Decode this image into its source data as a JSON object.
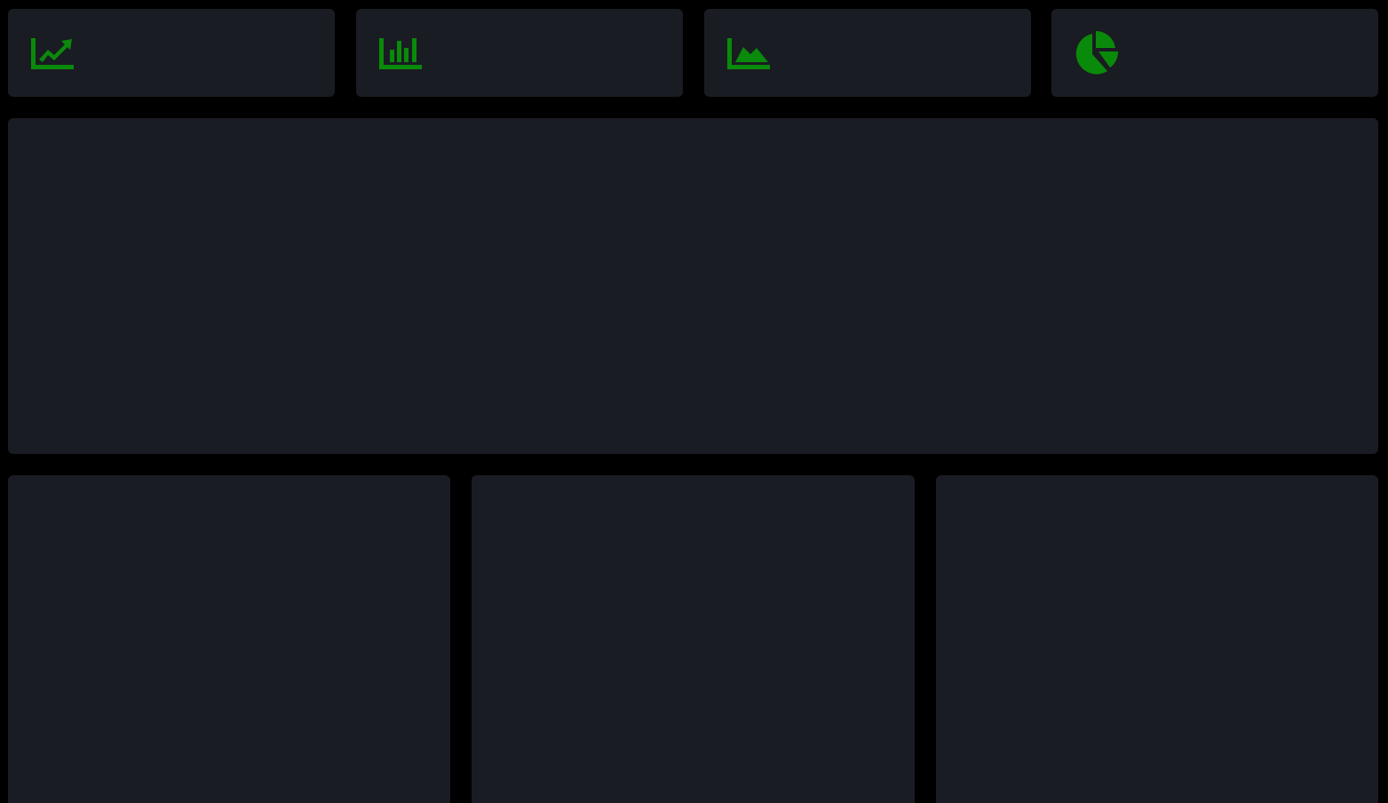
{
  "theme": {
    "background": "#000000",
    "panel": "#1a1c23",
    "accent": "#0a8a0a"
  },
  "stats": [
    {
      "icon": "line-chart-icon",
      "value": ""
    },
    {
      "icon": "bar-chart-icon",
      "value": ""
    },
    {
      "icon": "area-chart-icon",
      "value": ""
    },
    {
      "icon": "pie-chart-icon",
      "value": ""
    }
  ],
  "panels": {
    "main": {
      "title": ""
    },
    "bottom": [
      {
        "title": ""
      },
      {
        "title": ""
      },
      {
        "title": ""
      }
    ]
  }
}
